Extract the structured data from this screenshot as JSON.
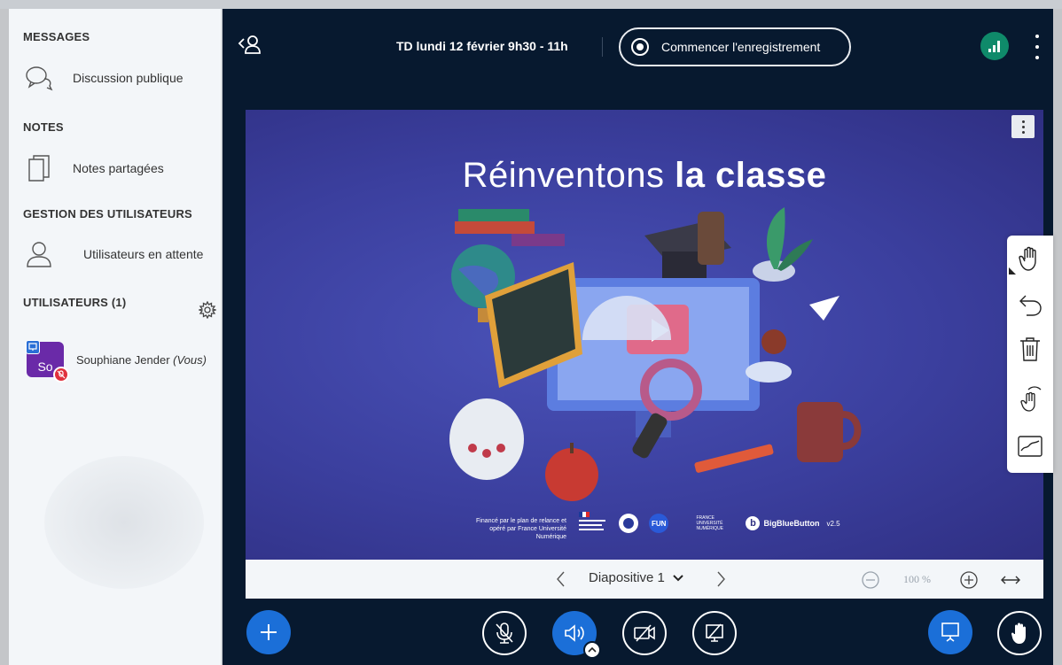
{
  "sidebar": {
    "messages_title": "MESSAGES",
    "public_chat": "Discussion publique",
    "notes_title": "NOTES",
    "shared_notes": "Notes partagées",
    "user_mgmt_title": "GESTION DES UTILISATEURS",
    "waiting_users": "Utilisateurs en attente",
    "users_title": "UTILISATEURS (1)",
    "user": {
      "initials": "So",
      "name": "Souphiane Jender",
      "you_tag": "(Vous)"
    }
  },
  "header": {
    "meeting_title": "TD lundi 12 février 9h30 - 11h",
    "record_label": "Commencer l'enregistrement",
    "connection_color": "#0f8a6a"
  },
  "slide": {
    "title_light": "Réinventons",
    "title_bold": "la classe",
    "footer_text": "Financé par le plan de relance et opéré par France Université Numérique",
    "logo_fun": "FUN",
    "logo_france": "FRANCE UNIVERSITÉ NUMÉRIQUE",
    "bbb_name": "BigBlueButton",
    "bbb_version": "v2.5"
  },
  "tools": [
    "hand-tool-icon",
    "undo-icon",
    "trash-icon",
    "multi-user-icon",
    "whiteboard-icon"
  ],
  "slide_nav": {
    "current_slide": "Diapositive 1",
    "zoom": "100 %"
  },
  "colors": {
    "primary_blue": "#1b6fd8",
    "main_bg": "#07192f",
    "avatar": "#6a2aa8",
    "muted_red": "#e0313d"
  }
}
